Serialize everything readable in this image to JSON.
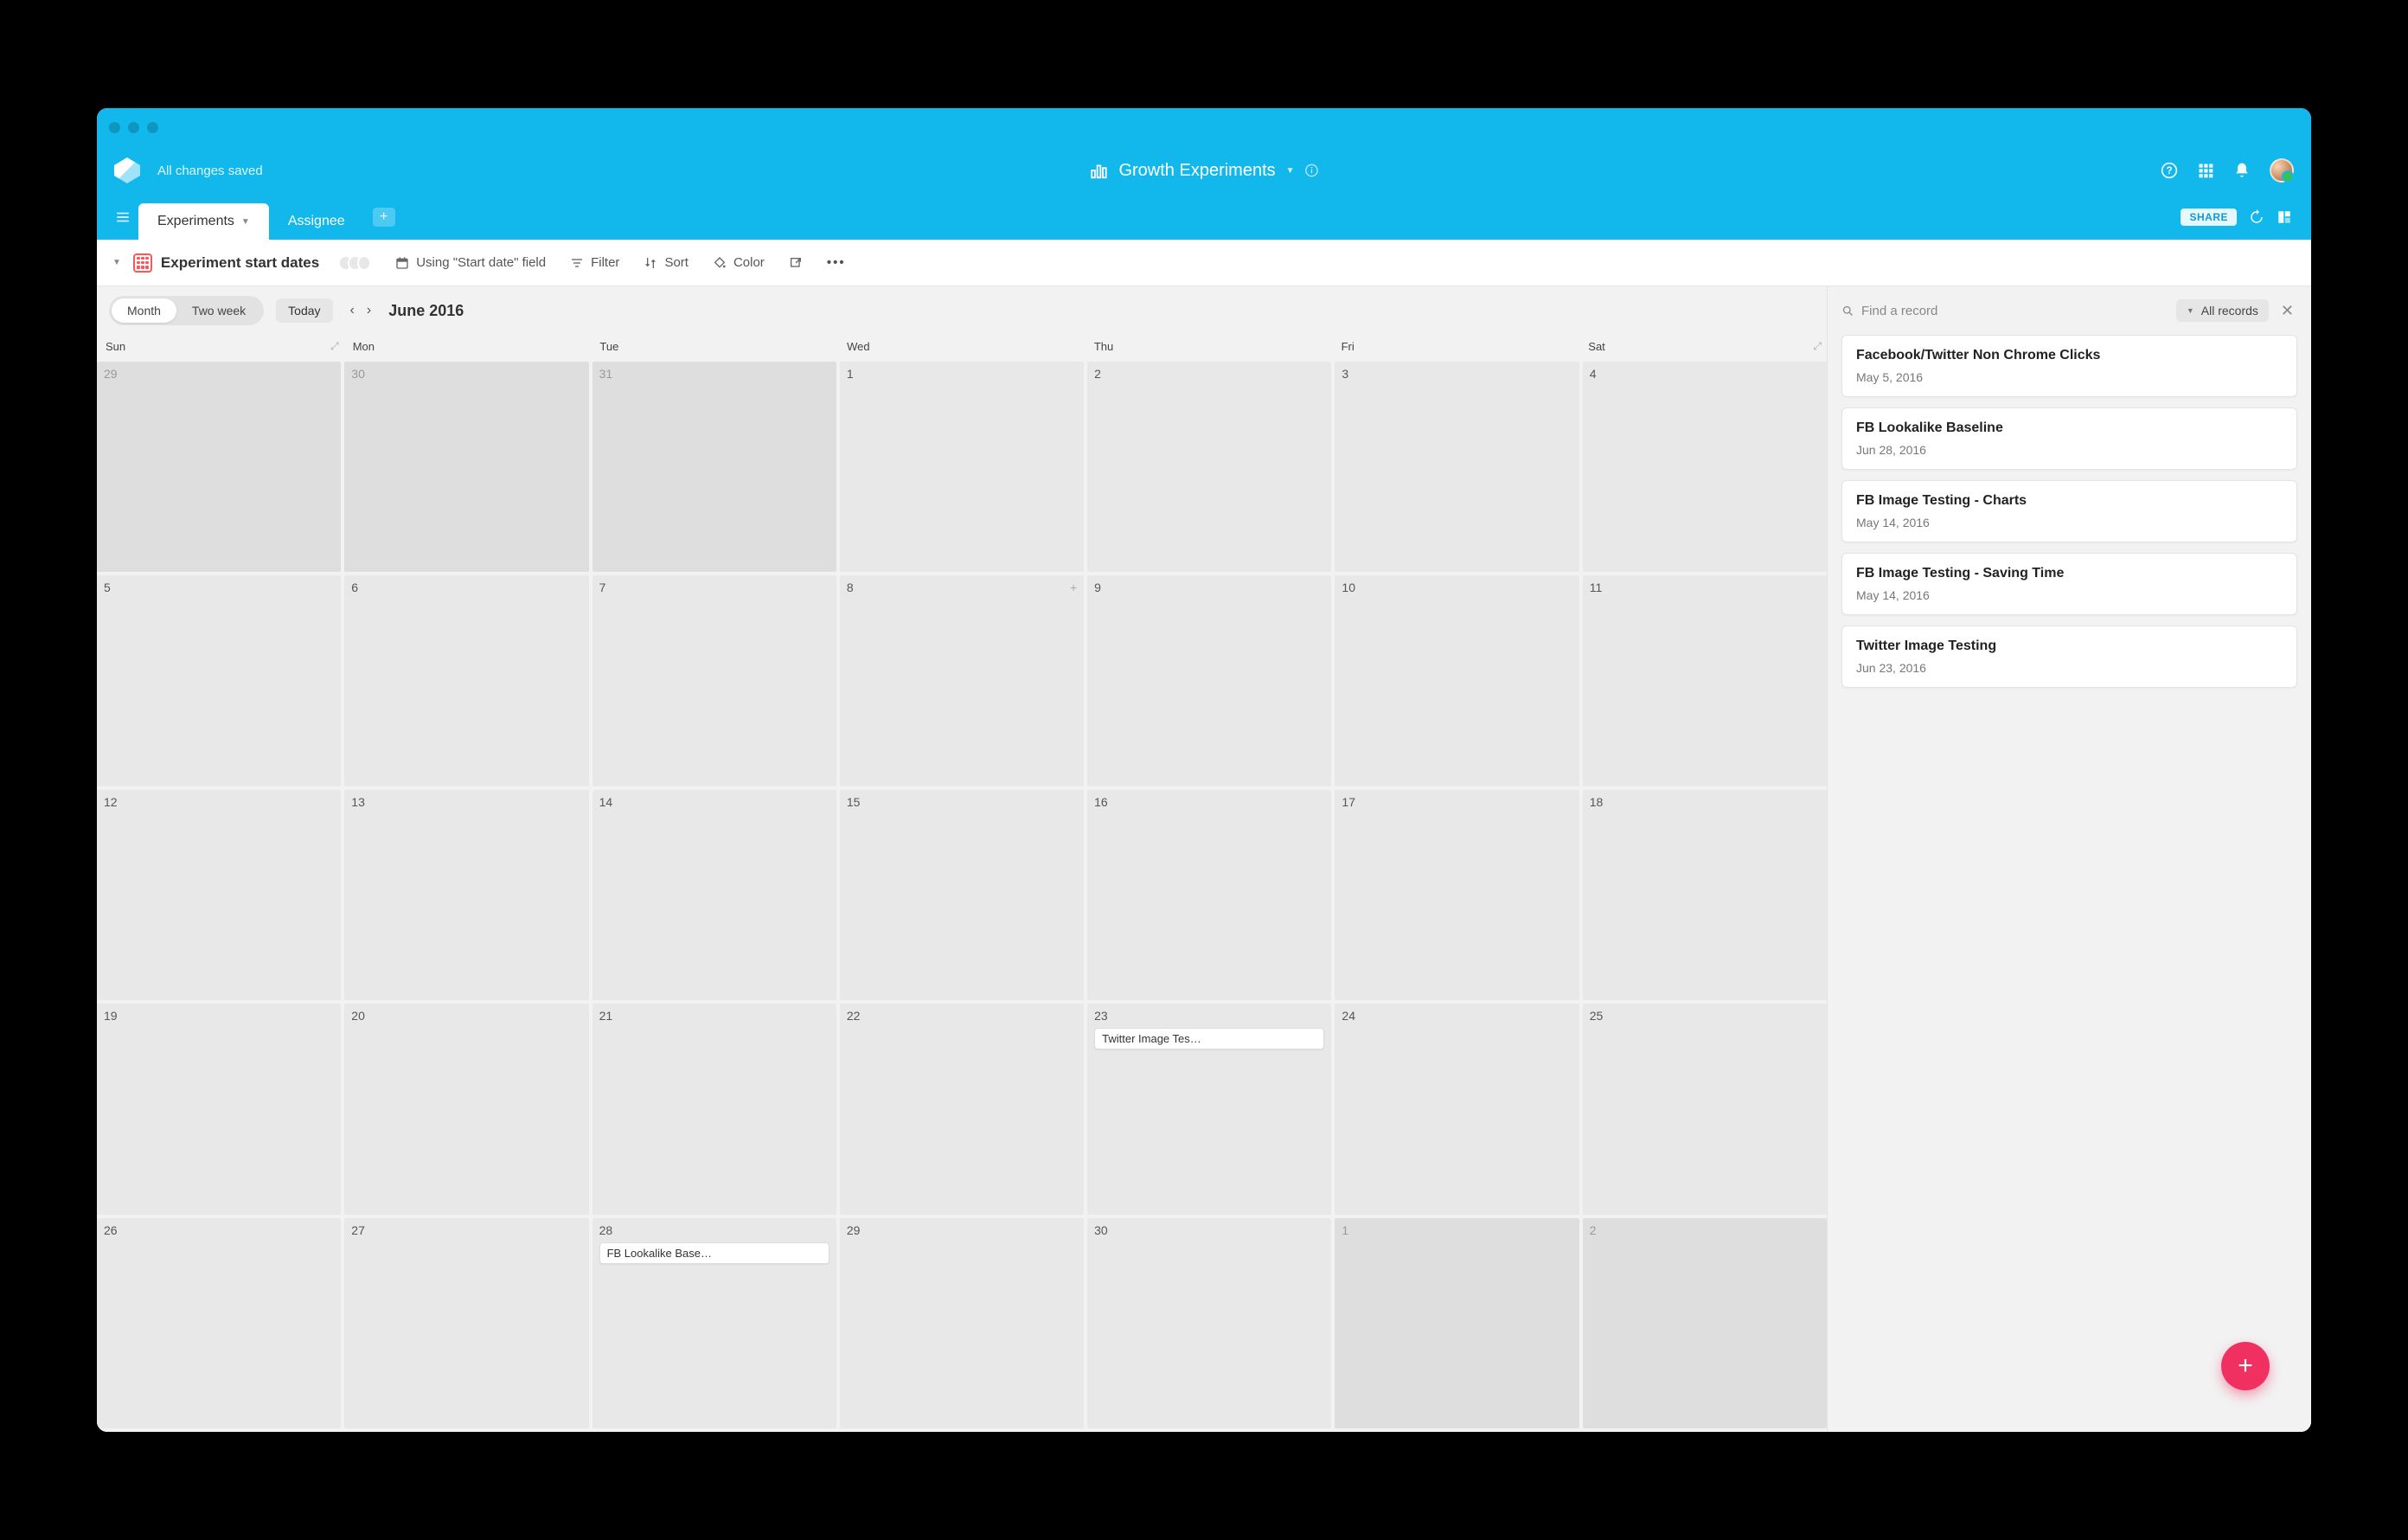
{
  "header": {
    "saved_text": "All changes saved",
    "base_title": "Growth Experiments"
  },
  "tabs": {
    "items": [
      {
        "label": "Experiments",
        "active": true
      },
      {
        "label": "Assignee",
        "active": false
      }
    ],
    "share_label": "SHARE"
  },
  "toolbar": {
    "view_name": "Experiment start dates",
    "using_field": "Using \"Start date\" field",
    "filter": "Filter",
    "sort": "Sort",
    "color": "Color"
  },
  "calendar": {
    "seg_month": "Month",
    "seg_two_week": "Two week",
    "today": "Today",
    "month_label": "June 2016",
    "weekdays": [
      "Sun",
      "Mon",
      "Tue",
      "Wed",
      "Thu",
      "Fri",
      "Sat"
    ],
    "cells": [
      {
        "n": "29",
        "out": true
      },
      {
        "n": "30",
        "out": true
      },
      {
        "n": "31",
        "out": true
      },
      {
        "n": "1"
      },
      {
        "n": "2"
      },
      {
        "n": "3"
      },
      {
        "n": "4"
      },
      {
        "n": "5"
      },
      {
        "n": "6"
      },
      {
        "n": "7"
      },
      {
        "n": "8",
        "show_add": true
      },
      {
        "n": "9"
      },
      {
        "n": "10"
      },
      {
        "n": "11"
      },
      {
        "n": "12"
      },
      {
        "n": "13"
      },
      {
        "n": "14"
      },
      {
        "n": "15"
      },
      {
        "n": "16"
      },
      {
        "n": "17"
      },
      {
        "n": "18"
      },
      {
        "n": "19"
      },
      {
        "n": "20"
      },
      {
        "n": "21"
      },
      {
        "n": "22"
      },
      {
        "n": "23",
        "event": "Twitter Image Tes…"
      },
      {
        "n": "24"
      },
      {
        "n": "25"
      },
      {
        "n": "26"
      },
      {
        "n": "27"
      },
      {
        "n": "28",
        "event": "FB Lookalike Base…"
      },
      {
        "n": "29"
      },
      {
        "n": "30"
      },
      {
        "n": "1",
        "out": true
      },
      {
        "n": "2",
        "out": true
      }
    ]
  },
  "side": {
    "search_placeholder": "Find a record",
    "records_chip": "All records",
    "cards": [
      {
        "title": "Facebook/Twitter Non Chrome Clicks",
        "date": "May 5, 2016"
      },
      {
        "title": "FB Lookalike Baseline",
        "date": "Jun 28, 2016"
      },
      {
        "title": "FB Image Testing - Charts",
        "date": "May 14, 2016"
      },
      {
        "title": "FB Image Testing - Saving Time",
        "date": "May 14, 2016"
      },
      {
        "title": "Twitter Image Testing",
        "date": "Jun 23, 2016"
      }
    ]
  }
}
